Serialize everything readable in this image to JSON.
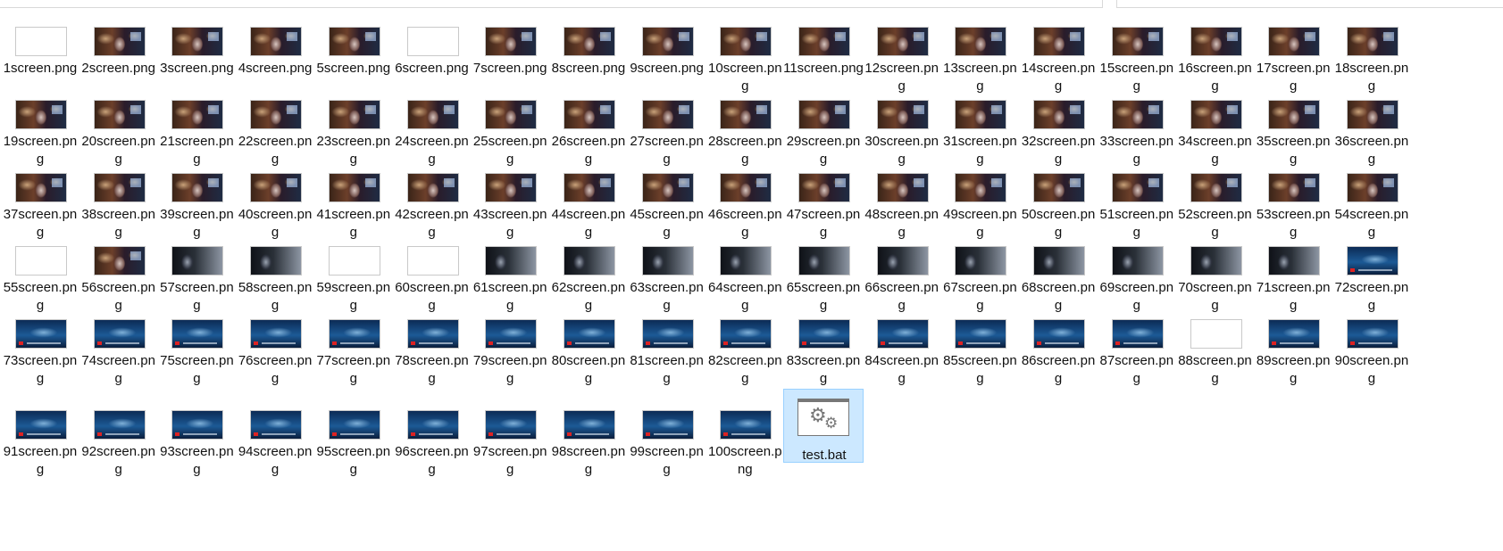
{
  "files": [
    {
      "name": "1screen.png",
      "type": "blank"
    },
    {
      "name": "2screen.png",
      "type": "game"
    },
    {
      "name": "3screen.png",
      "type": "game"
    },
    {
      "name": "4screen.png",
      "type": "game"
    },
    {
      "name": "5screen.png",
      "type": "game"
    },
    {
      "name": "6screen.png",
      "type": "blank"
    },
    {
      "name": "7screen.png",
      "type": "game"
    },
    {
      "name": "8screen.png",
      "type": "game"
    },
    {
      "name": "9screen.png",
      "type": "game"
    },
    {
      "name": "10screen.png",
      "type": "game"
    },
    {
      "name": "11screen.png",
      "type": "game"
    },
    {
      "name": "12screen.png",
      "type": "game"
    },
    {
      "name": "13screen.png",
      "type": "game"
    },
    {
      "name": "14screen.png",
      "type": "game"
    },
    {
      "name": "15screen.png",
      "type": "game"
    },
    {
      "name": "16screen.png",
      "type": "game"
    },
    {
      "name": "17screen.png",
      "type": "game"
    },
    {
      "name": "18screen.png",
      "type": "game"
    },
    {
      "name": "19screen.png",
      "type": "game"
    },
    {
      "name": "20screen.png",
      "type": "game"
    },
    {
      "name": "21screen.png",
      "type": "game"
    },
    {
      "name": "22screen.png",
      "type": "game"
    },
    {
      "name": "23screen.png",
      "type": "game"
    },
    {
      "name": "24screen.png",
      "type": "game"
    },
    {
      "name": "25screen.png",
      "type": "game"
    },
    {
      "name": "26screen.png",
      "type": "game"
    },
    {
      "name": "27screen.png",
      "type": "game"
    },
    {
      "name": "28screen.png",
      "type": "game"
    },
    {
      "name": "29screen.png",
      "type": "game"
    },
    {
      "name": "30screen.png",
      "type": "game"
    },
    {
      "name": "31screen.png",
      "type": "game"
    },
    {
      "name": "32screen.png",
      "type": "game"
    },
    {
      "name": "33screen.png",
      "type": "game"
    },
    {
      "name": "34screen.png",
      "type": "game"
    },
    {
      "name": "35screen.png",
      "type": "game"
    },
    {
      "name": "36screen.png",
      "type": "game"
    },
    {
      "name": "37screen.png",
      "type": "game"
    },
    {
      "name": "38screen.png",
      "type": "game"
    },
    {
      "name": "39screen.png",
      "type": "game"
    },
    {
      "name": "40screen.png",
      "type": "game"
    },
    {
      "name": "41screen.png",
      "type": "game"
    },
    {
      "name": "42screen.png",
      "type": "game"
    },
    {
      "name": "43screen.png",
      "type": "game"
    },
    {
      "name": "44screen.png",
      "type": "game"
    },
    {
      "name": "45screen.png",
      "type": "game"
    },
    {
      "name": "46screen.png",
      "type": "game"
    },
    {
      "name": "47screen.png",
      "type": "game"
    },
    {
      "name": "48screen.png",
      "type": "game"
    },
    {
      "name": "49screen.png",
      "type": "game"
    },
    {
      "name": "50screen.png",
      "type": "game"
    },
    {
      "name": "51screen.png",
      "type": "game"
    },
    {
      "name": "52screen.png",
      "type": "game"
    },
    {
      "name": "53screen.png",
      "type": "game"
    },
    {
      "name": "54screen.png",
      "type": "game"
    },
    {
      "name": "55screen.png",
      "type": "blank"
    },
    {
      "name": "56screen.png",
      "type": "game"
    },
    {
      "name": "57screen.png",
      "type": "dark"
    },
    {
      "name": "58screen.png",
      "type": "dark"
    },
    {
      "name": "59screen.png",
      "type": "blank"
    },
    {
      "name": "60screen.png",
      "type": "blank"
    },
    {
      "name": "61screen.png",
      "type": "dark"
    },
    {
      "name": "62screen.png",
      "type": "dark"
    },
    {
      "name": "63screen.png",
      "type": "dark"
    },
    {
      "name": "64screen.png",
      "type": "dark"
    },
    {
      "name": "65screen.png",
      "type": "dark"
    },
    {
      "name": "66screen.png",
      "type": "dark"
    },
    {
      "name": "67screen.png",
      "type": "dark"
    },
    {
      "name": "68screen.png",
      "type": "dark"
    },
    {
      "name": "69screen.png",
      "type": "dark"
    },
    {
      "name": "70screen.png",
      "type": "dark"
    },
    {
      "name": "71screen.png",
      "type": "dark"
    },
    {
      "name": "72screen.png",
      "type": "ocean"
    },
    {
      "name": "73screen.png",
      "type": "ocean"
    },
    {
      "name": "74screen.png",
      "type": "ocean"
    },
    {
      "name": "75screen.png",
      "type": "ocean"
    },
    {
      "name": "76screen.png",
      "type": "ocean"
    },
    {
      "name": "77screen.png",
      "type": "ocean"
    },
    {
      "name": "78screen.png",
      "type": "ocean"
    },
    {
      "name": "79screen.png",
      "type": "ocean"
    },
    {
      "name": "80screen.png",
      "type": "ocean"
    },
    {
      "name": "81screen.png",
      "type": "ocean"
    },
    {
      "name": "82screen.png",
      "type": "ocean"
    },
    {
      "name": "83screen.png",
      "type": "ocean"
    },
    {
      "name": "84screen.png",
      "type": "ocean"
    },
    {
      "name": "85screen.png",
      "type": "ocean"
    },
    {
      "name": "86screen.png",
      "type": "ocean"
    },
    {
      "name": "87screen.png",
      "type": "ocean"
    },
    {
      "name": "88screen.png",
      "type": "blank"
    },
    {
      "name": "89screen.png",
      "type": "ocean"
    },
    {
      "name": "90screen.png",
      "type": "ocean"
    },
    {
      "name": "91screen.png",
      "type": "ocean"
    },
    {
      "name": "92screen.png",
      "type": "ocean"
    },
    {
      "name": "93screen.png",
      "type": "ocean"
    },
    {
      "name": "94screen.png",
      "type": "ocean"
    },
    {
      "name": "95screen.png",
      "type": "ocean"
    },
    {
      "name": "96screen.png",
      "type": "ocean"
    },
    {
      "name": "97screen.png",
      "type": "ocean"
    },
    {
      "name": "98screen.png",
      "type": "ocean"
    },
    {
      "name": "99screen.png",
      "type": "ocean"
    },
    {
      "name": "100screen.png",
      "type": "ocean"
    },
    {
      "name": "test.bat",
      "type": "bat",
      "selected": true,
      "icon": "gears-icon"
    }
  ],
  "colors": {
    "selection_bg": "#cce8ff",
    "selection_border": "#99d1ff"
  }
}
